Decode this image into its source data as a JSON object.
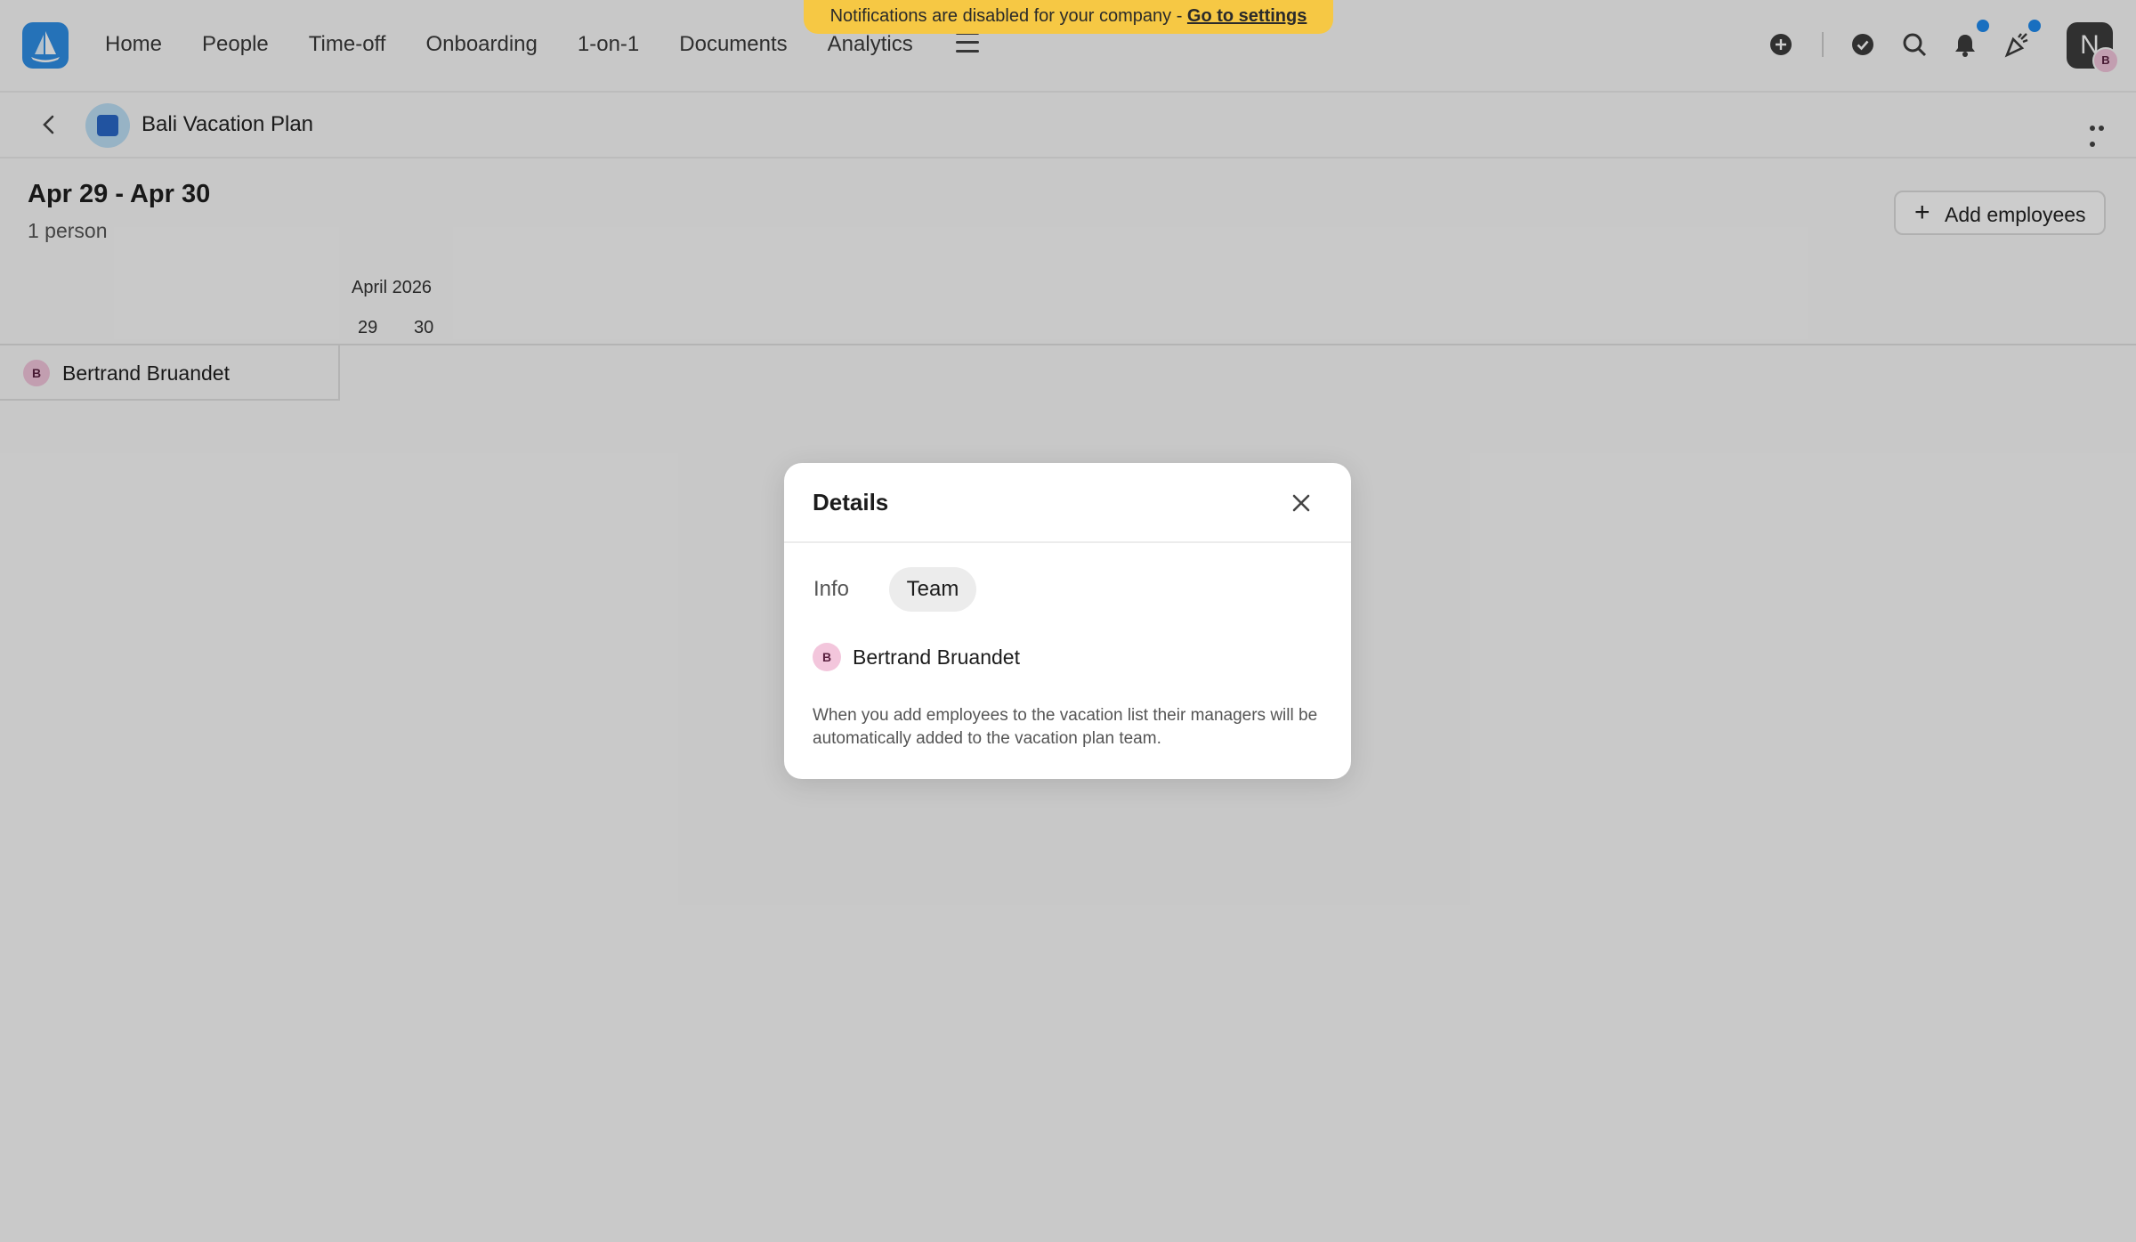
{
  "banner": {
    "text": "Notifications are disabled for your company - ",
    "link": "Go to settings"
  },
  "nav": {
    "items": [
      "Home",
      "People",
      "Time-off",
      "Onboarding",
      "1-on-1",
      "Documents",
      "Analytics"
    ]
  },
  "header_icons": [
    "plus-circle-icon",
    "check-circle-icon",
    "search-icon",
    "bell-icon",
    "celebration-icon"
  ],
  "user": {
    "initial": "N",
    "badge_initial": "B"
  },
  "plan": {
    "title": "Bali Vacation Plan"
  },
  "content": {
    "date_range": "Apr 29 - Apr 30",
    "person_count": "1 person",
    "add_button": "Add employees",
    "month_label": "April 2026",
    "days": [
      "29",
      "30"
    ],
    "rows": [
      {
        "initial": "B",
        "name": "Bertrand Bruandet"
      }
    ]
  },
  "modal": {
    "title": "Details",
    "tabs": [
      "Info",
      "Team"
    ],
    "active_tab": "Team",
    "members": [
      {
        "initial": "B",
        "name": "Bertrand Bruandet"
      }
    ],
    "note": "When you add employees to the vacation list their managers will be automatically added to the vacation plan team."
  },
  "colors": {
    "accent": "#2f8fe6",
    "banner": "#f6c844",
    "notification_dot": "#1f8bf0"
  }
}
